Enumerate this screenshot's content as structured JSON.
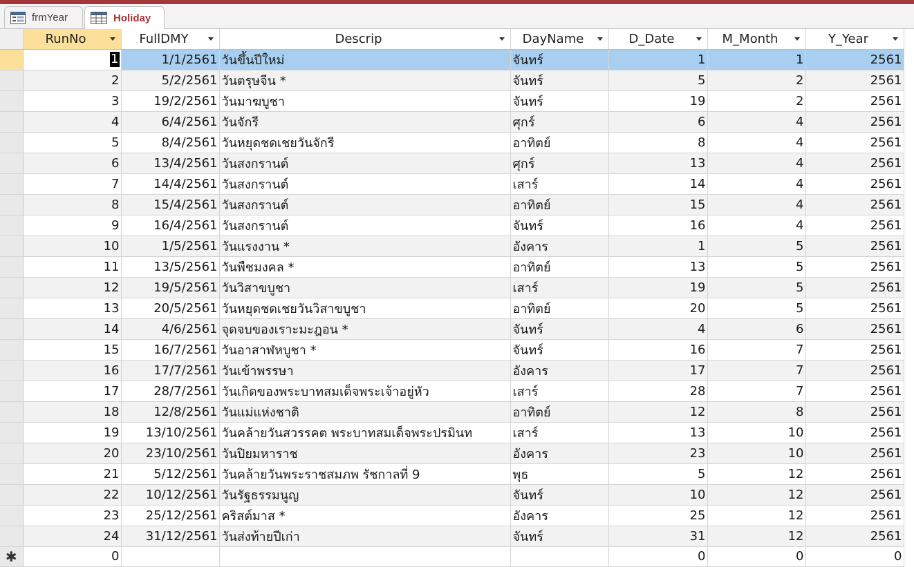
{
  "tabs": [
    {
      "label": "frmYear",
      "icon": "form-icon",
      "active": false
    },
    {
      "label": "Holiday",
      "icon": "table-icon",
      "active": true
    }
  ],
  "columns": [
    {
      "key": "RunNo",
      "label": "RunNo"
    },
    {
      "key": "FullDMY",
      "label": "FullDMY"
    },
    {
      "key": "Descrip",
      "label": "Descrip"
    },
    {
      "key": "DayName",
      "label": "DayName"
    },
    {
      "key": "D_Date",
      "label": "D_Date"
    },
    {
      "key": "M_Month",
      "label": "M_Month"
    },
    {
      "key": "Y_Year",
      "label": "Y_Year"
    }
  ],
  "rows": [
    {
      "RunNo": "1",
      "FullDMY": "1/1/2561",
      "Descrip": "วันขึ้นปีใหม่",
      "DayName": "จันทร์",
      "D_Date": "1",
      "M_Month": "1",
      "Y_Year": "2561"
    },
    {
      "RunNo": "2",
      "FullDMY": "5/2/2561",
      "Descrip": "วันตรุษจีน *",
      "DayName": "จันทร์",
      "D_Date": "5",
      "M_Month": "2",
      "Y_Year": "2561"
    },
    {
      "RunNo": "3",
      "FullDMY": "19/2/2561",
      "Descrip": "วันมาฆบูชา",
      "DayName": "จันทร์",
      "D_Date": "19",
      "M_Month": "2",
      "Y_Year": "2561"
    },
    {
      "RunNo": "4",
      "FullDMY": "6/4/2561",
      "Descrip": "วันจักรี",
      "DayName": "ศุกร์",
      "D_Date": "6",
      "M_Month": "4",
      "Y_Year": "2561"
    },
    {
      "RunNo": "5",
      "FullDMY": "8/4/2561",
      "Descrip": "วันหยุดชดเชยวันจักรี",
      "DayName": "อาทิตย์",
      "D_Date": "8",
      "M_Month": "4",
      "Y_Year": "2561"
    },
    {
      "RunNo": "6",
      "FullDMY": "13/4/2561",
      "Descrip": "วันสงกรานต์",
      "DayName": "ศุกร์",
      "D_Date": "13",
      "M_Month": "4",
      "Y_Year": "2561"
    },
    {
      "RunNo": "7",
      "FullDMY": "14/4/2561",
      "Descrip": "วันสงกรานต์",
      "DayName": "เสาร์",
      "D_Date": "14",
      "M_Month": "4",
      "Y_Year": "2561"
    },
    {
      "RunNo": "8",
      "FullDMY": "15/4/2561",
      "Descrip": "วันสงกรานต์",
      "DayName": "อาทิตย์",
      "D_Date": "15",
      "M_Month": "4",
      "Y_Year": "2561"
    },
    {
      "RunNo": "9",
      "FullDMY": "16/4/2561",
      "Descrip": "วันสงกรานต์",
      "DayName": "จันทร์",
      "D_Date": "16",
      "M_Month": "4",
      "Y_Year": "2561"
    },
    {
      "RunNo": "10",
      "FullDMY": "1/5/2561",
      "Descrip": "วันแรงงาน *",
      "DayName": "อังคาร",
      "D_Date": "1",
      "M_Month": "5",
      "Y_Year": "2561"
    },
    {
      "RunNo": "11",
      "FullDMY": "13/5/2561",
      "Descrip": "วันพืชมงคล *",
      "DayName": "อาทิตย์",
      "D_Date": "13",
      "M_Month": "5",
      "Y_Year": "2561"
    },
    {
      "RunNo": "12",
      "FullDMY": "19/5/2561",
      "Descrip": "วันวิสาขบูชา",
      "DayName": "เสาร์",
      "D_Date": "19",
      "M_Month": "5",
      "Y_Year": "2561"
    },
    {
      "RunNo": "13",
      "FullDMY": "20/5/2561",
      "Descrip": "วันหยุดชดเชยวันวิสาขบูชา",
      "DayName": "อาทิตย์",
      "D_Date": "20",
      "M_Month": "5",
      "Y_Year": "2561"
    },
    {
      "RunNo": "14",
      "FullDMY": "4/6/2561",
      "Descrip": "จุดจบของเราะมะฎอน *",
      "DayName": "จันทร์",
      "D_Date": "4",
      "M_Month": "6",
      "Y_Year": "2561"
    },
    {
      "RunNo": "15",
      "FullDMY": "16/7/2561",
      "Descrip": "วันอาสาฬหบูชา *",
      "DayName": "จันทร์",
      "D_Date": "16",
      "M_Month": "7",
      "Y_Year": "2561"
    },
    {
      "RunNo": "16",
      "FullDMY": "17/7/2561",
      "Descrip": "วันเข้าพรรษา",
      "DayName": "อังคาร",
      "D_Date": "17",
      "M_Month": "7",
      "Y_Year": "2561"
    },
    {
      "RunNo": "17",
      "FullDMY": "28/7/2561",
      "Descrip": "วันเกิดของพระบาทสมเด็จพระเจ้าอยู่หัว",
      "DayName": "เสาร์",
      "D_Date": "28",
      "M_Month": "7",
      "Y_Year": "2561"
    },
    {
      "RunNo": "18",
      "FullDMY": "12/8/2561",
      "Descrip": "วันแม่แห่งชาติ",
      "DayName": "อาทิตย์",
      "D_Date": "12",
      "M_Month": "8",
      "Y_Year": "2561"
    },
    {
      "RunNo": "19",
      "FullDMY": "13/10/2561",
      "Descrip": "วันคล้ายวันสวรรคต พระบาทสมเด็จพระปรมินท",
      "DayName": "เสาร์",
      "D_Date": "13",
      "M_Month": "10",
      "Y_Year": "2561"
    },
    {
      "RunNo": "20",
      "FullDMY": "23/10/2561",
      "Descrip": "วันปิยมหาราช",
      "DayName": "อังคาร",
      "D_Date": "23",
      "M_Month": "10",
      "Y_Year": "2561"
    },
    {
      "RunNo": "21",
      "FullDMY": "5/12/2561",
      "Descrip": "วันคล้ายวันพระราชสมภพ รัชกาลที่ 9",
      "DayName": "พุธ",
      "D_Date": "5",
      "M_Month": "12",
      "Y_Year": "2561"
    },
    {
      "RunNo": "22",
      "FullDMY": "10/12/2561",
      "Descrip": "วันรัฐธรรมนูญ",
      "DayName": "จันทร์",
      "D_Date": "10",
      "M_Month": "12",
      "Y_Year": "2561"
    },
    {
      "RunNo": "23",
      "FullDMY": "25/12/2561",
      "Descrip": "คริสต์มาส *",
      "DayName": "อังคาร",
      "D_Date": "25",
      "M_Month": "12",
      "Y_Year": "2561"
    },
    {
      "RunNo": "24",
      "FullDMY": "31/12/2561",
      "Descrip": "วันส่งท้ายปีเก่า",
      "DayName": "จันทร์",
      "D_Date": "31",
      "M_Month": "12",
      "Y_Year": "2561"
    }
  ],
  "new_row": {
    "marker": "✱",
    "RunNo": "0",
    "D_Date": "0",
    "M_Month": "0",
    "Y_Year": "0"
  },
  "colors": {
    "accent": "#a4373a",
    "selected_row": "#a9cff0",
    "sorted_header": "#fce09a"
  }
}
